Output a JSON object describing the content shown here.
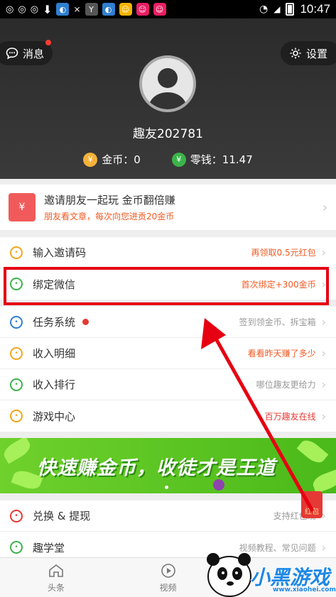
{
  "status_bar": {
    "left_icons": [
      "weibo-icon",
      "weibo-icon",
      "weibo-icon",
      "download-icon",
      "app-icon",
      "signal-x-icon",
      "app-icon",
      "app-icon",
      "face-app-icon",
      "face-app-icon",
      "face-app-icon"
    ],
    "time": "10:47"
  },
  "header": {
    "messages_label": "消息",
    "settings_label": "设置",
    "username": "趣友202781",
    "coins_label": "金币：0",
    "change_label": "零钱：11.47"
  },
  "invite": {
    "title": "邀请朋友一起玩 金币翻倍赚",
    "subtitle": "朋友看文章，每次向您进贡20金币"
  },
  "list1": [
    {
      "label": "输入邀请码",
      "right": "再领取0.5元红包",
      "right_color": "#f15a24",
      "icon_color": "#f4a51c"
    },
    {
      "label": "绑定微信",
      "right": "首次绑定+300金币",
      "right_color": "#f15a24",
      "icon_color": "#3cb34a"
    }
  ],
  "list2": [
    {
      "label": "任务系统",
      "right": "签到领金币、拆宝箱",
      "right_color": "#999999",
      "icon_color": "#2f7fd1"
    },
    {
      "label": "收入明细",
      "right": "看看昨天赚了多少",
      "right_color": "#f15a24",
      "icon_color": "#f4a51c"
    },
    {
      "label": "收入排行",
      "right": "哪位趣友更给力",
      "right_color": "#999999",
      "icon_color": "#3cb34a"
    },
    {
      "label": "游戏中心",
      "right": "百万趣友在线",
      "right_color": "#e53935",
      "icon_color": "#f4a51c"
    }
  ],
  "banner": {
    "text": "快速赚金币，收徒才是王道"
  },
  "list3": [
    {
      "label": "兑换 & 提现",
      "right": "支持红包现",
      "right_color": "#999999",
      "icon_color": "#e53935"
    },
    {
      "label": "趣学堂",
      "right": "视频教程、常见问题",
      "right_color": "#999999",
      "icon_color": "#3cb34a"
    }
  ],
  "red_packet_label": "红包",
  "bottom_nav": [
    {
      "label": "头条",
      "icon": "home-icon"
    },
    {
      "label": "视频",
      "icon": "play-icon"
    },
    {
      "label": "",
      "icon": "mine-icon"
    }
  ],
  "watermark": {
    "brand": "小黑游戏",
    "url": "www.xiaohei.com"
  },
  "colors": {
    "accent_red": "#e60012",
    "header_bg": "#333333",
    "banner_green": "#5cc323"
  }
}
